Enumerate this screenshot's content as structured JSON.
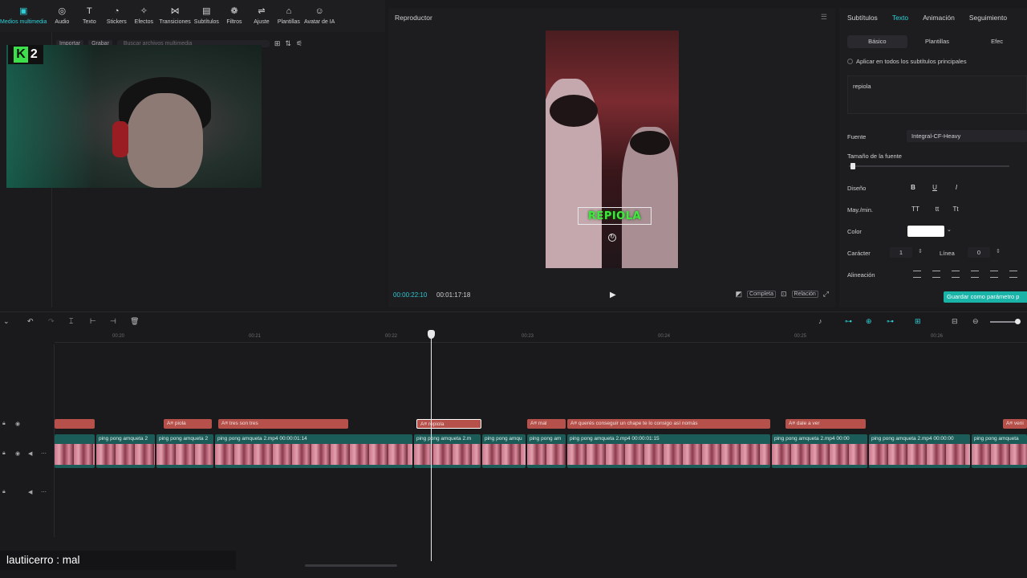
{
  "toolbar": {
    "items": [
      {
        "label": "Medios multimedia",
        "icon": "media-icon"
      },
      {
        "label": "Audio",
        "icon": "audio-icon"
      },
      {
        "label": "Texto",
        "icon": "text-icon"
      },
      {
        "label": "Stickers",
        "icon": "sticker-icon"
      },
      {
        "label": "Efectos",
        "icon": "effects-icon"
      },
      {
        "label": "Transiciones",
        "icon": "transition-icon"
      },
      {
        "label": "Subtítulos",
        "icon": "subtitles-icon"
      },
      {
        "label": "Filtros",
        "icon": "filter-icon"
      },
      {
        "label": "Ajuste",
        "icon": "adjust-icon"
      },
      {
        "label": "Plantillas",
        "icon": "templates-icon"
      },
      {
        "label": "Avatar de IA",
        "icon": "avatar-icon"
      }
    ],
    "active": "Medios multimedia",
    "accent": "#2fd0d8"
  },
  "media": {
    "import_label": "Importar",
    "record_label": "Grabar",
    "search_placeholder": "Buscar archivos multimedia"
  },
  "overlay": {
    "logo_letter": "K",
    "logo_number": "2"
  },
  "player": {
    "title": "Reproductor",
    "caption": "REPIOLA",
    "time_current": "00:00:22:10",
    "time_total": "00:01:17:18",
    "btn_full": "Completa",
    "btn_ratio": "Relación"
  },
  "inspector": {
    "tabs": [
      "Subtítulos",
      "Texto",
      "Animación",
      "Seguimiento"
    ],
    "active_tab": "Texto",
    "subtabs": [
      "Básico",
      "Plantillas",
      "Efec"
    ],
    "apply_all": "Aplicar en todos los subtítulos principales",
    "text_value": "repiola",
    "font_label": "Fuente",
    "font_value": "Integral-CF-Heavy",
    "size_label": "Tamaño de la fuente",
    "design_label": "Diseño",
    "case_label": "May./min.",
    "color_label": "Color",
    "color_value": "#ffffff",
    "char_label": "Carácter",
    "char_value": "1",
    "line_label": "Línea",
    "line_value": "0",
    "align_label": "Alineación",
    "save_label": "Guardar como parámetro p"
  },
  "timeline": {
    "ticks": [
      "00:20",
      "00:21",
      "00:22",
      "00:23",
      "00:24",
      "00:25",
      "00:26"
    ],
    "captions": [
      {
        "text": "",
        "selected": false
      },
      {
        "text": "piola",
        "selected": false
      },
      {
        "text": "tres son tres",
        "selected": false
      },
      {
        "text": "repiola",
        "selected": true
      },
      {
        "text": "mal",
        "selected": false
      },
      {
        "text": "querés conseguir un chape te lo consigo así nomás",
        "selected": false
      },
      {
        "text": "dale a ver",
        "selected": false
      },
      {
        "text": "veni",
        "selected": false
      }
    ],
    "clips": [
      "",
      "ping pong amqueta 2",
      "ping pong amqueta 2",
      "ping pong amqueta 2.mp4   00:00:01:14",
      "ping pong amqueta 2.m",
      "ping pong amqu",
      "ping pong am",
      "ping pong amqueta 2.mp4   00:00:01:15",
      "ping pong amqueta 2.mp4   00:00",
      "ping pong amqueta 2.mp4   00:00:00",
      "ping pong amqueta"
    ]
  },
  "chat": {
    "message": "lautiicerro : mal"
  }
}
